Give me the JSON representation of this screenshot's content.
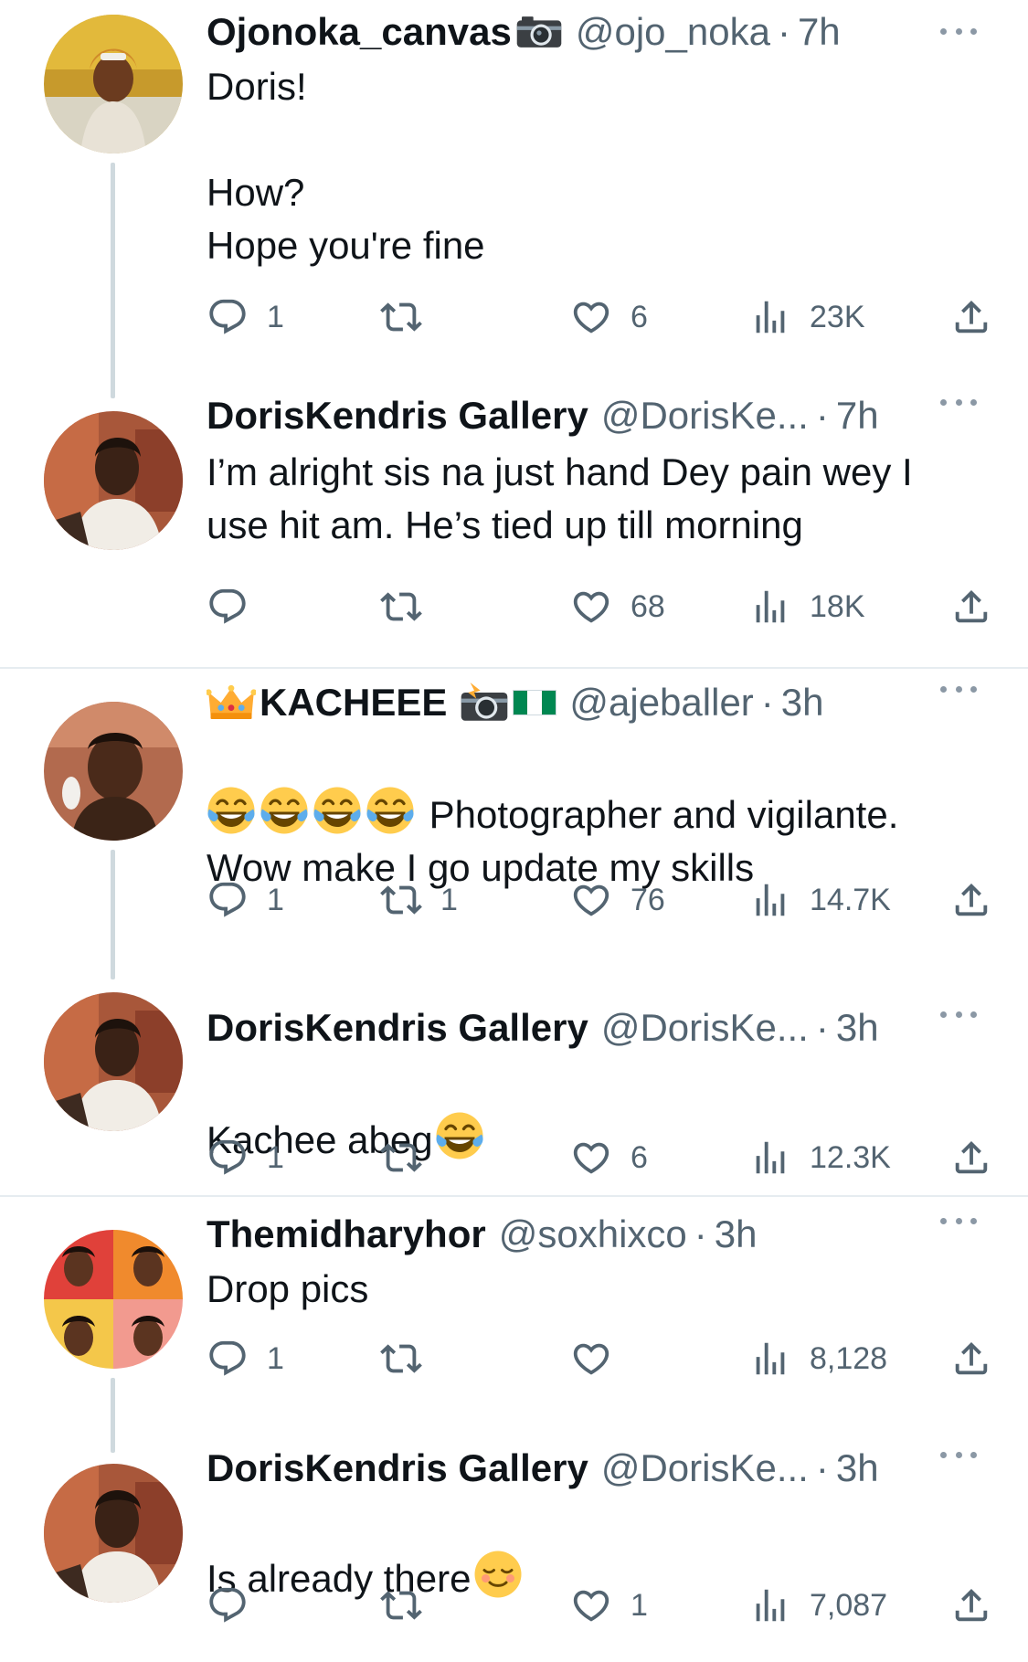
{
  "tweets": [
    {
      "name": "Ojonoka_canvas",
      "handle": "@ojo_noka",
      "time": "7h",
      "text": "Doris!\n\nHow?\nHope you're  fine",
      "replies": "1",
      "retweets": "",
      "likes": "6",
      "views": "23K",
      "badges": [
        "camera-emoji"
      ]
    },
    {
      "name": "DorisKendris Gallery",
      "handle": "@DorisKe...",
      "time": "7h",
      "text": "I’m alright sis na just hand Dey pain wey I use hit am. He’s tied up till morning",
      "replies": "",
      "retweets": "",
      "likes": "68",
      "views": "18K"
    },
    {
      "name": "KACHEEE",
      "handle": "@ajeballer",
      "time": "3h",
      "text": "Photographer and vigilante. Wow make I go update my skills",
      "replies": "1",
      "retweets": "1",
      "likes": "76",
      "views": "14.7K",
      "badges": [
        "crown-emoji",
        "camera-flash-emoji",
        "nigeria-flag-emoji"
      ],
      "leading_emojis": [
        "tears-of-joy-emoji",
        "tears-of-joy-emoji",
        "tears-of-joy-emoji",
        "tears-of-joy-emoji"
      ]
    },
    {
      "name": "DorisKendris Gallery",
      "handle": "@DorisKe...",
      "time": "3h",
      "text": "Kachee abeg",
      "replies": "1",
      "retweets": "",
      "likes": "6",
      "views": "12.3K",
      "trailing_emoji": "tears-of-joy-emoji"
    },
    {
      "name": "Themidharyhor",
      "handle": "@soxhixco",
      "time": "3h",
      "text": "Drop pics",
      "replies": "1",
      "retweets": "",
      "likes": "",
      "views": "8,128"
    },
    {
      "name": "DorisKendris Gallery",
      "handle": "@DorisKe...",
      "time": "3h",
      "text": "Is already there",
      "replies": "",
      "retweets": "",
      "likes": "1",
      "views": "7,087",
      "trailing_emoji": "relieved-face-emoji"
    }
  ],
  "colors": {
    "text": "#0f1419",
    "secondary": "#536471",
    "thread_line": "#cfd9de",
    "divider": "#e6ecf0"
  },
  "icons": [
    "reply-icon",
    "retweet-icon",
    "like-icon",
    "views-icon",
    "share-icon",
    "more-icon"
  ]
}
